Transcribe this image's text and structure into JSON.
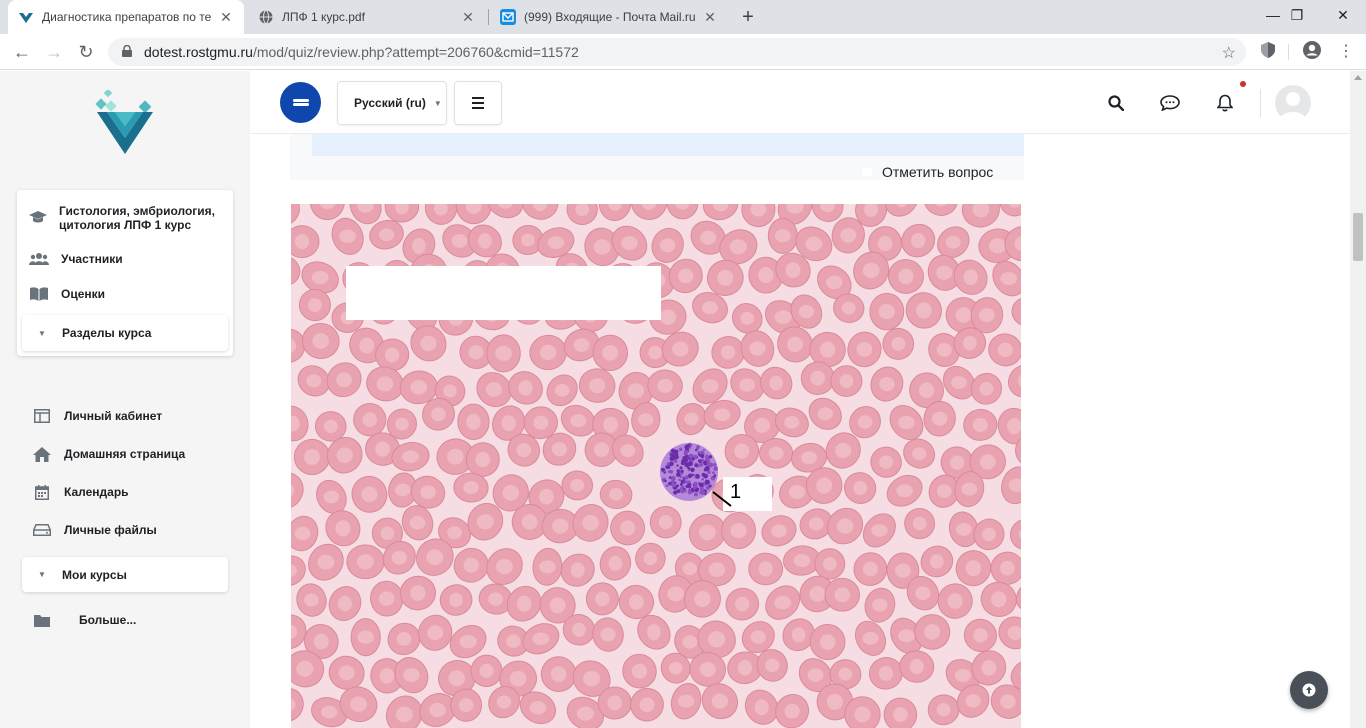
{
  "browser": {
    "tabs": [
      {
        "label": "Диагностика препаратов по те",
        "icon": "site-logo-icon"
      },
      {
        "label": "ЛПФ 1 курс.pdf",
        "icon": "globe-icon"
      },
      {
        "label": "(999) Входящие - Почта Mail.ru",
        "icon": "mail-icon"
      }
    ],
    "url_host": "dotest.rostgmu.ru",
    "url_path": "/mod/quiz/review.php?attempt=206760&cmid=11572"
  },
  "sidebar": {
    "course_items": [
      {
        "label": "Гистология, эмбриология, цитология ЛПФ 1 курс",
        "icon": "graduation-cap-icon"
      },
      {
        "label": "Участники",
        "icon": "users-icon"
      },
      {
        "label": "Оценки",
        "icon": "book-icon"
      }
    ],
    "sections_label": "Разделы курса",
    "nav_items": [
      {
        "label": "Личный кабинет",
        "icon": "dashboard-icon"
      },
      {
        "label": "Домашняя страница",
        "icon": "home-icon"
      },
      {
        "label": "Календарь",
        "icon": "calendar-icon"
      },
      {
        "label": "Личные файлы",
        "icon": "drive-icon"
      }
    ],
    "my_courses_label": "Мои курсы",
    "more_label": "Больше..."
  },
  "topnav": {
    "language": "Русский (ru)"
  },
  "question": {
    "flag_label": "Отметить вопрос",
    "marker_number": "1"
  },
  "colors": {
    "brand_blue": "#0f47ad",
    "info_bg": "#e7f0fd",
    "notif_dot": "#d0312d"
  }
}
